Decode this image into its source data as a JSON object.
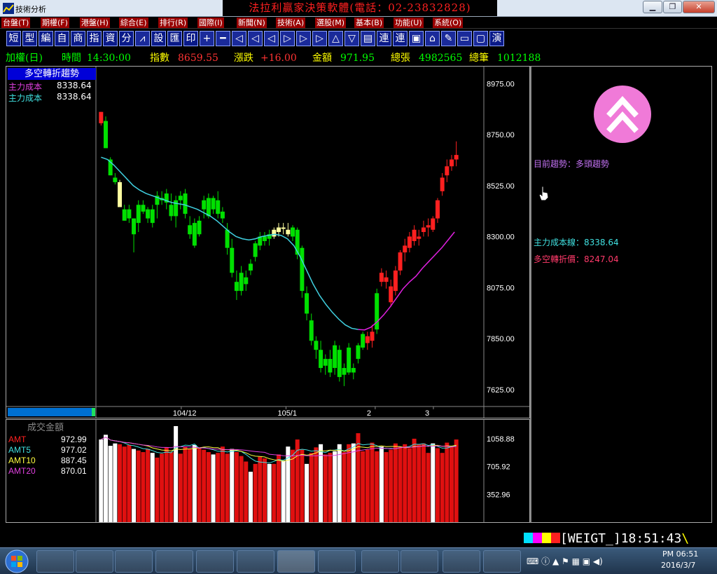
{
  "window": {
    "title": "技術分析",
    "banner": "法拉利贏家決策軟體(電話：02-23832828)"
  },
  "menu": [
    "台盤(T)",
    "期權(F)",
    "港盤(H)",
    "綜合(E)",
    "排行(R)",
    "國際(I)",
    "新聞(N)",
    "技術(A)",
    "選股(M)",
    "基本(B)",
    "功能(U)",
    "系統(O)"
  ],
  "toolbar": {
    "text_buttons": [
      "短",
      "型",
      "編",
      "自",
      "商",
      "指",
      "資",
      "分"
    ],
    "text_buttons2": [
      "設",
      "匯",
      "印"
    ],
    "text_buttons3": [
      "連",
      "連"
    ],
    "last": "演"
  },
  "infobar": {
    "name": "加權(日)",
    "time_label": "時間",
    "time": "14:30:00",
    "index_label": "指數",
    "index": "8659.55",
    "change_label": "漲跌",
    "change": "+16.00",
    "amount_label": "金額",
    "amount": "971.95",
    "vol_label": "總張",
    "vol": "4982565",
    "count_label": "總筆",
    "count": "1012188"
  },
  "indicator": {
    "title": "多空轉折趨勢",
    "line1_label": "主力成本",
    "line1_value": "8338.64",
    "line2_label": "主力成本",
    "line2_value": "8338.64"
  },
  "price_axis": [
    "8975.00",
    "8750.00",
    "8525.00",
    "8300.00",
    "8075.00",
    "7850.00",
    "7625.00"
  ],
  "date_axis": [
    "104/12",
    "105/1",
    "2",
    "3"
  ],
  "volume": {
    "title": "成交金額",
    "legend": [
      {
        "label": "AMT",
        "value": "972.99",
        "color": "#ff2020"
      },
      {
        "label": "AMT5",
        "value": "977.02",
        "color": "#40e0e0"
      },
      {
        "label": "AMT10",
        "value": "887.45",
        "color": "#ffff40"
      },
      {
        "label": "AMT20",
        "value": "870.01",
        "color": "#e040e0"
      }
    ],
    "axis": [
      "1058.88",
      "705.92",
      "352.96"
    ]
  },
  "side": {
    "trend_label": "目前趨勢：",
    "trend_value": "多頭趨勢",
    "cost_line_label": "主力成本線：",
    "cost_line_value": "8338.64",
    "turn_price_label": "多空轉折價：",
    "turn_price_value": "8247.04"
  },
  "status": {
    "code": "[WEIGT_]",
    "time": "18:51:43",
    "tail": "\\"
  },
  "system_tray": {
    "time": "PM 06:51",
    "date": "2016/3/7"
  },
  "colors": {
    "up": "#ff2020",
    "down": "#00e000",
    "neutral": "#ffffa0",
    "ma_line": "#40d0e0",
    "turn_line": "#e020e0"
  },
  "chart_data": {
    "type": "candlestick",
    "price_range": [
      7550,
      9050
    ],
    "candles": [
      [
        8850,
        8850,
        8790,
        8800,
        "u"
      ],
      [
        8810,
        8830,
        8690,
        8690,
        "d"
      ],
      [
        8640,
        8650,
        8570,
        8570,
        "d"
      ],
      [
        8560,
        8580,
        8530,
        8540,
        "d"
      ],
      [
        8540,
        8550,
        8440,
        8430,
        "n"
      ],
      [
        8420,
        8440,
        8370,
        8370,
        "d"
      ],
      [
        8380,
        8440,
        8360,
        8420,
        "d"
      ],
      [
        8380,
        8380,
        8230,
        8310,
        "d"
      ],
      [
        8360,
        8460,
        8320,
        8440,
        "d"
      ],
      [
        8440,
        8460,
        8400,
        8410,
        "d"
      ],
      [
        8380,
        8430,
        8360,
        8420,
        "d"
      ],
      [
        8420,
        8440,
        8340,
        8360,
        "d"
      ],
      [
        8440,
        8500,
        8380,
        8480,
        "d"
      ],
      [
        8470,
        8500,
        8440,
        8460,
        "d"
      ],
      [
        8450,
        8510,
        8420,
        8490,
        "d"
      ],
      [
        8440,
        8490,
        8370,
        8390,
        "d"
      ],
      [
        8390,
        8480,
        8340,
        8460,
        "d"
      ],
      [
        8460,
        8500,
        8420,
        8480,
        "d"
      ],
      [
        8490,
        8510,
        8380,
        8400,
        "d"
      ],
      [
        8350,
        8390,
        8290,
        8310,
        "d"
      ],
      [
        8360,
        8380,
        8250,
        8260,
        "d"
      ],
      [
        8310,
        8390,
        8300,
        8370,
        "d"
      ],
      [
        8420,
        8480,
        8380,
        8460,
        "d"
      ],
      [
        8470,
        8490,
        8380,
        8390,
        "d"
      ],
      [
        8420,
        8480,
        8400,
        8470,
        "d"
      ],
      [
        8460,
        8500,
        8380,
        8400,
        "d"
      ],
      [
        8410,
        8430,
        8360,
        8380,
        "d"
      ],
      [
        8330,
        8360,
        8220,
        8250,
        "d"
      ],
      [
        8250,
        8290,
        8120,
        8140,
        "d"
      ],
      [
        8060,
        8150,
        8020,
        8100,
        "d"
      ],
      [
        8140,
        8170,
        8040,
        8060,
        "d"
      ],
      [
        8090,
        8150,
        8060,
        8120,
        "d"
      ],
      [
        8150,
        8200,
        8130,
        8180,
        "d"
      ],
      [
        8210,
        8280,
        8190,
        8270,
        "d"
      ],
      [
        8260,
        8320,
        8240,
        8300,
        "d"
      ],
      [
        8300,
        8320,
        8260,
        8280,
        "d"
      ],
      [
        8290,
        8330,
        8260,
        8310,
        "d"
      ],
      [
        8300,
        8340,
        8290,
        8330,
        "n"
      ],
      [
        8320,
        8360,
        8300,
        8340,
        "n"
      ],
      [
        8340,
        8360,
        8310,
        8340,
        "n"
      ],
      [
        8330,
        8360,
        8300,
        8310,
        "n"
      ],
      [
        8300,
        8350,
        8280,
        8340,
        "d"
      ],
      [
        8330,
        8340,
        8200,
        8220,
        "d"
      ],
      [
        8250,
        8260,
        8030,
        8060,
        "d"
      ],
      [
        8050,
        8080,
        7930,
        7960,
        "d"
      ],
      [
        7930,
        7960,
        7820,
        7840,
        "d"
      ],
      [
        7840,
        7860,
        7760,
        7800,
        "d"
      ],
      [
        7800,
        7840,
        7700,
        7720,
        "d"
      ],
      [
        7730,
        7780,
        7690,
        7760,
        "d"
      ],
      [
        7760,
        7800,
        7680,
        7700,
        "d"
      ],
      [
        7720,
        7840,
        7690,
        7820,
        "d"
      ],
      [
        7800,
        7820,
        7660,
        7680,
        "d"
      ],
      [
        7690,
        7740,
        7640,
        7720,
        "d"
      ],
      [
        7700,
        7830,
        7690,
        7810,
        "d"
      ],
      [
        7700,
        7740,
        7670,
        7720,
        "d"
      ],
      [
        7760,
        7830,
        7740,
        7820,
        "d"
      ],
      [
        7810,
        7880,
        7800,
        7870,
        "d"
      ],
      [
        7830,
        7880,
        7800,
        7860,
        "u"
      ],
      [
        7840,
        7910,
        7810,
        7880,
        "u"
      ],
      [
        7890,
        8070,
        7870,
        8050,
        "d"
      ],
      [
        8100,
        8160,
        8080,
        8140,
        "u"
      ],
      [
        8120,
        8150,
        8070,
        8100,
        "u"
      ],
      [
        8080,
        8110,
        7990,
        8010,
        "u"
      ],
      [
        8060,
        8170,
        8040,
        8150,
        "u"
      ],
      [
        8150,
        8240,
        8130,
        8230,
        "u"
      ],
      [
        8230,
        8290,
        8190,
        8260,
        "u"
      ],
      [
        8250,
        8320,
        8230,
        8300,
        "u"
      ],
      [
        8280,
        8350,
        8260,
        8330,
        "u"
      ],
      [
        8290,
        8330,
        8260,
        8300,
        "u"
      ],
      [
        8320,
        8370,
        8300,
        8340,
        "u"
      ],
      [
        8340,
        8380,
        8300,
        8350,
        "u"
      ],
      [
        8330,
        8390,
        8320,
        8380,
        "u"
      ],
      [
        8380,
        8470,
        8360,
        8460,
        "u"
      ],
      [
        8500,
        8580,
        8480,
        8560,
        "u"
      ],
      [
        8570,
        8640,
        8540,
        8610,
        "u"
      ],
      [
        8610,
        8660,
        8590,
        8640,
        "u"
      ],
      [
        8640,
        8720,
        8610,
        8660,
        "u"
      ]
    ],
    "ma_points": [
      8650,
      8640,
      8615,
      8585,
      8555,
      8525,
      8505,
      8490,
      8480,
      8470,
      8460,
      8450,
      8445,
      8440,
      8430,
      8420,
      8405,
      8390,
      8370,
      8345,
      8320,
      8300,
      8290,
      8285,
      8290,
      8300,
      8305,
      8310,
      8305,
      8290,
      8260,
      8210,
      8150,
      8090,
      8040,
      8000,
      7965,
      7935,
      7910,
      7895,
      7890,
      7888,
      7900,
      7925,
      7955,
      7990,
      8030,
      8070,
      8100,
      8125,
      8160,
      8190,
      8220,
      8250,
      8285,
      8320
    ],
    "volume_values": [
      1050,
      1110,
      970,
      1000,
      990,
      960,
      980,
      930,
      910,
      890,
      930,
      880,
      820,
      870,
      950,
      890,
      1220,
      870,
      960,
      930,
      980,
      950,
      920,
      890,
      860,
      880,
      960,
      870,
      930,
      890,
      840,
      770,
      640,
      740,
      830,
      810,
      740,
      740,
      860,
      780,
      960,
      920,
      1050,
      920,
      740,
      880,
      950,
      990,
      860,
      880,
      900,
      990,
      890,
      990,
      1000,
      1130,
      900,
      920,
      1010,
      900,
      960,
      890,
      920,
      1000,
      960,
      990,
      940,
      1060,
      990,
      1000,
      880,
      1000,
      940,
      880,
      1010,
      960,
      1050,
      1030,
      960,
      1000,
      1040
    ],
    "volume_colors": "wwwwrrrwrrrwrrrrwrrrwrrrwrrrwrrrwrrrwrrwwrrrwrrwrrwwrrwrrrrrwrrrrrrrrrrwrrrrrrrr",
    "ylim": [
      0,
      1300
    ]
  }
}
